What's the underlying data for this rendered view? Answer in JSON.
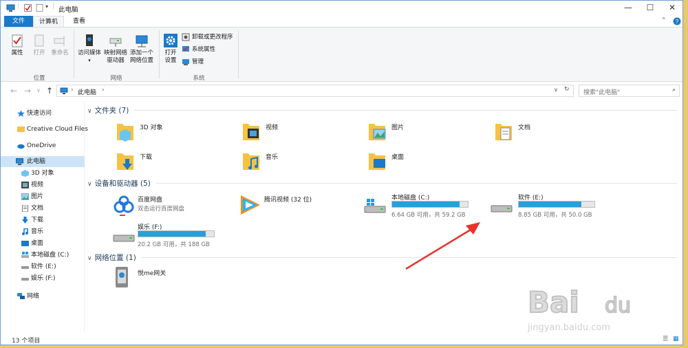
{
  "window": {
    "title": "此电脑"
  },
  "tabs": [
    {
      "label": "文件"
    },
    {
      "label": "计算机"
    },
    {
      "label": "查看"
    }
  ],
  "ribbon": {
    "location": {
      "group": "位置",
      "properties": "属性",
      "open": "打开",
      "rename": "重命名"
    },
    "network": {
      "group": "网络",
      "media_line1": "访问媒体",
      "map_line1": "映射网络",
      "map_line2": "驱动器",
      "add_line1": "添加一个",
      "add_line2": "网络位置"
    },
    "system": {
      "group": "系统",
      "settings_line1": "打开",
      "settings_line2": "设置",
      "uninstall": "卸载或更改程序",
      "sysprops": "系统属性",
      "manage": "管理"
    }
  },
  "address": {
    "path": "此电脑",
    "search_placeholder": "搜索\"此电脑\""
  },
  "nav": {
    "quick_access": "快速访问",
    "creative_cloud": "Creative Cloud Files",
    "onedrive": "OneDrive",
    "this_pc": "此电脑",
    "items": [
      "3D 对象",
      "视频",
      "图片",
      "文档",
      "下载",
      "音乐",
      "桌面",
      "本地磁盘 (C:)",
      "软件 (E:)",
      "娱乐 (F:)"
    ],
    "network": "网络"
  },
  "groups": {
    "folders": {
      "title": "文件夹 (7)",
      "items": [
        "3D 对象",
        "视频",
        "图片",
        "文档",
        "下载",
        "音乐",
        "桌面"
      ]
    },
    "devices": {
      "title": "设备和驱动器 (5)"
    },
    "network": {
      "title": "网络位置 (1)",
      "item": "悦me网关"
    }
  },
  "devices": {
    "baidu": {
      "name": "百度网盘",
      "sub": "双击运行百度网盘"
    },
    "tencent": {
      "name": "腾讯视频 (32 位)"
    },
    "c": {
      "name": "本地磁盘 (C:)",
      "space": "6.64 GB 可用，共 59.2 GB",
      "used_fraction": 0.888
    },
    "e": {
      "name": "软件 (E:)",
      "space": "8.85 GB 可用，共 50.0 GB",
      "used_fraction": 0.823
    },
    "f": {
      "name": "娱乐 (F:)",
      "space": "20.2 GB 可用，共 188 GB",
      "used_fraction": 0.893
    }
  },
  "status": {
    "count": "13 个项目"
  },
  "colors": {
    "accent": "#1979ca",
    "bar_fill": "#26a0da",
    "folder": "#f5c244",
    "arrow": "#e8322c"
  }
}
